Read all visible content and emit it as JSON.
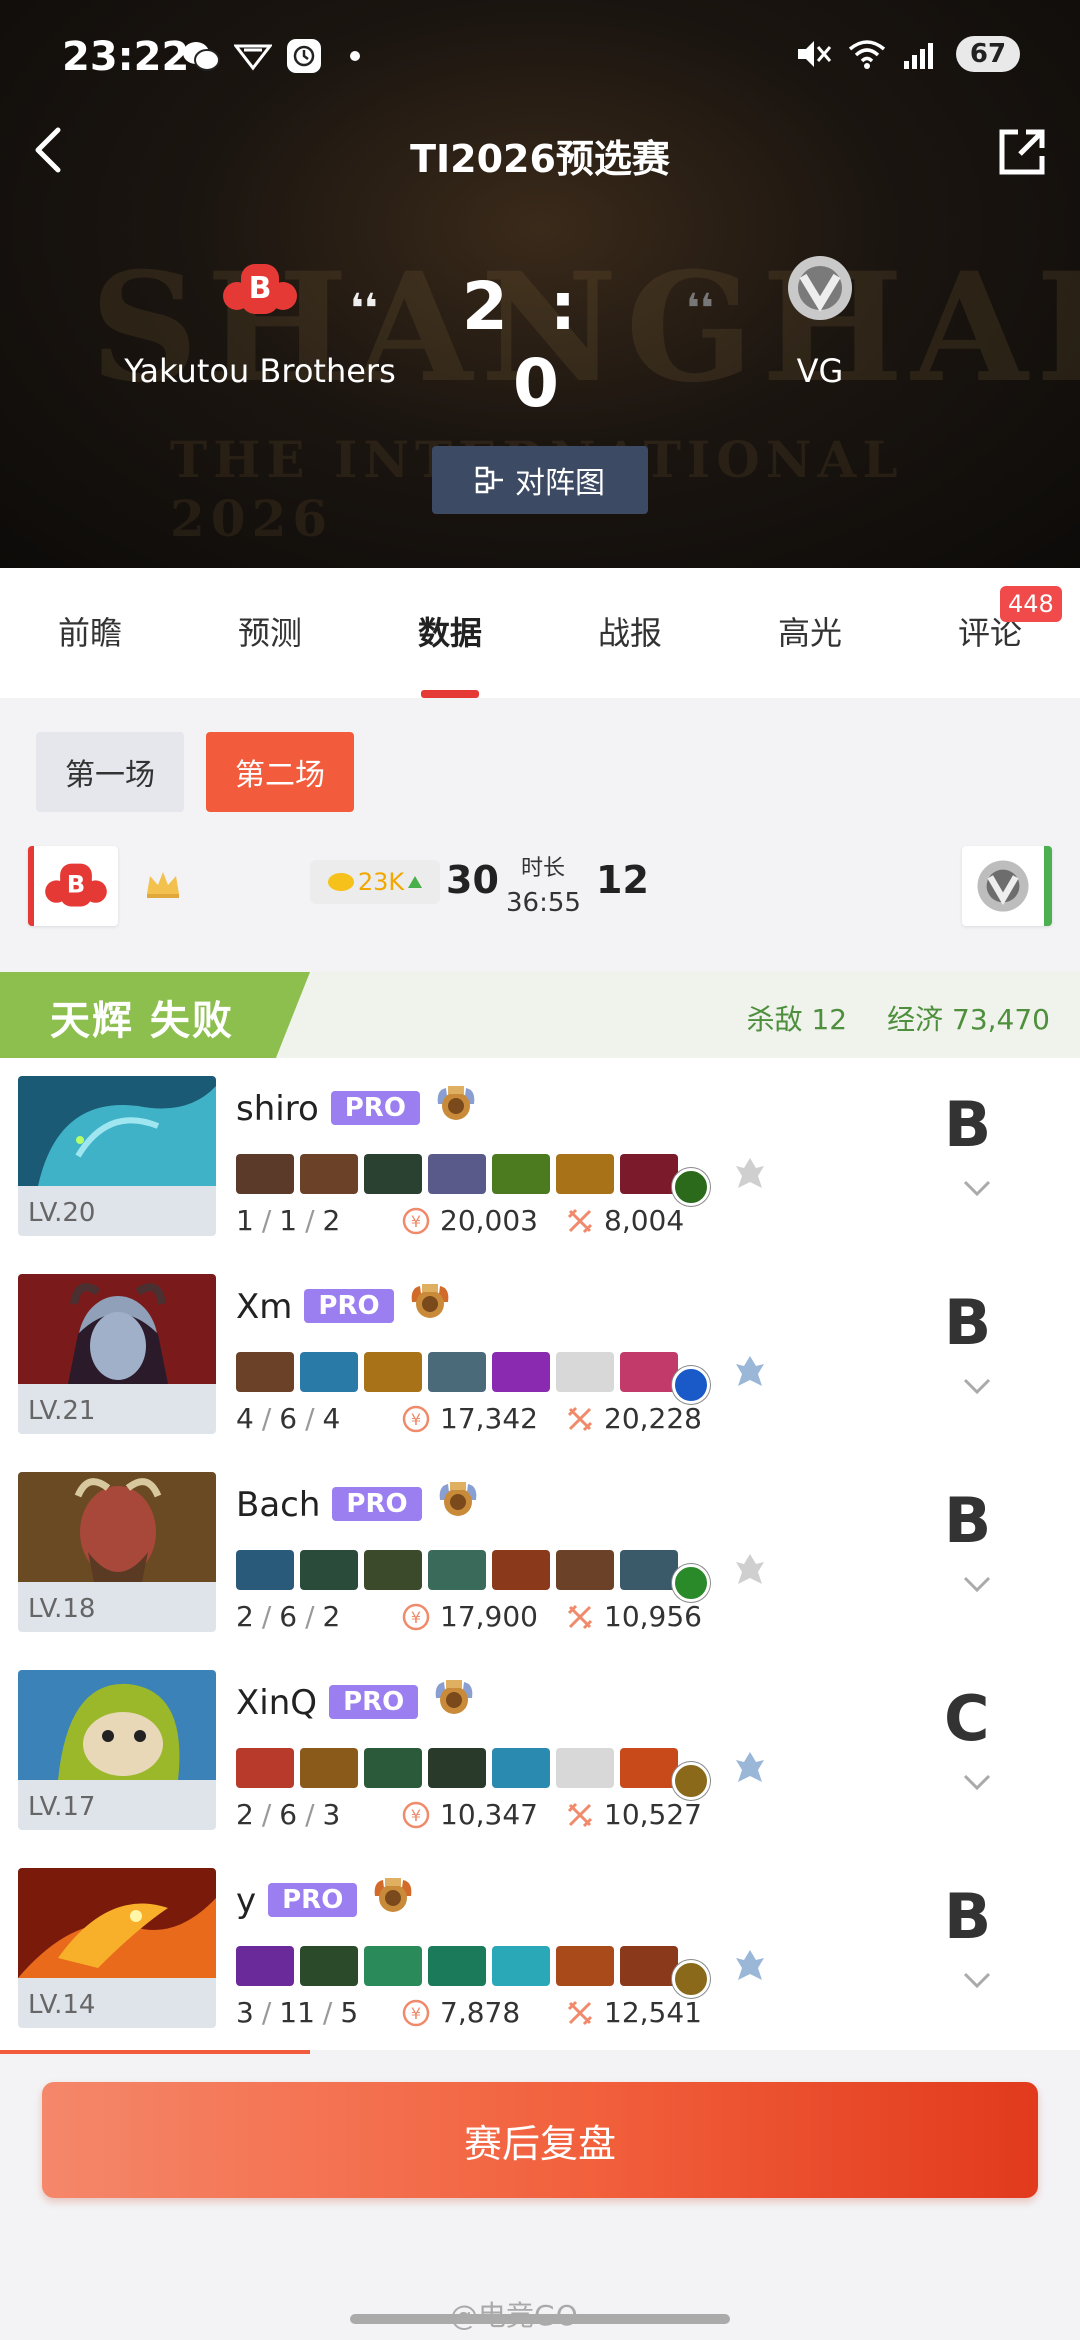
{
  "status_bar": {
    "time": "23:22",
    "battery": "67"
  },
  "header": {
    "title": "TI2026预选赛",
    "bracket_button": "对阵图"
  },
  "match": {
    "team_left": "Yakutou Brothers",
    "team_right": "VG",
    "score_left": "2",
    "score_colon": ":",
    "score_right": "0",
    "bg_text": "SHANGHAI",
    "bg_sub": "THE INTERNATIONAL 2026"
  },
  "tabs": [
    {
      "label": "前瞻"
    },
    {
      "label": "预测"
    },
    {
      "label": "数据",
      "active": true
    },
    {
      "label": "战报"
    },
    {
      "label": "高光"
    },
    {
      "label": "评论",
      "badge": "448"
    }
  ],
  "games": [
    {
      "label": "第一场"
    },
    {
      "label": "第二场",
      "active": true
    }
  ],
  "summary": {
    "gold_lead": "23K",
    "kills_left": "30",
    "duration_label": "时长",
    "duration": "36:55",
    "kills_right": "12"
  },
  "team_banner": {
    "title": "天辉 失败",
    "kills": "杀敌 12",
    "economy": "经济 73,470",
    "color": "#8cbf4e"
  },
  "players": [
    {
      "name": "shiro",
      "pro": "PRO",
      "level": "LV.20",
      "k": "1",
      "d": "1",
      "a": "2",
      "gold": "20,003",
      "damage": "8,004",
      "grade": "B"
    },
    {
      "name": "Xm",
      "pro": "PRO",
      "level": "LV.21",
      "k": "4",
      "d": "6",
      "a": "4",
      "gold": "17,342",
      "damage": "20,228",
      "grade": "B"
    },
    {
      "name": "Bach",
      "pro": "PRO",
      "level": "LV.18",
      "k": "2",
      "d": "6",
      "a": "2",
      "gold": "17,900",
      "damage": "10,956",
      "grade": "B"
    },
    {
      "name": "XinQ",
      "pro": "PRO",
      "level": "LV.17",
      "k": "2",
      "d": "6",
      "a": "3",
      "gold": "10,347",
      "damage": "10,527",
      "grade": "C"
    },
    {
      "name": "y",
      "pro": "PRO",
      "level": "LV.14",
      "k": "3",
      "d": "11",
      "a": "5",
      "gold": "7,878",
      "damage": "12,541",
      "grade": "B"
    }
  ],
  "review_button": "赛后复盘",
  "watermark": "@电竞GO",
  "colors": {
    "accent": "#f25c3c",
    "pro": "#9b7ef0",
    "win_green": "#4caf50",
    "badge_red": "#f04a4a"
  }
}
